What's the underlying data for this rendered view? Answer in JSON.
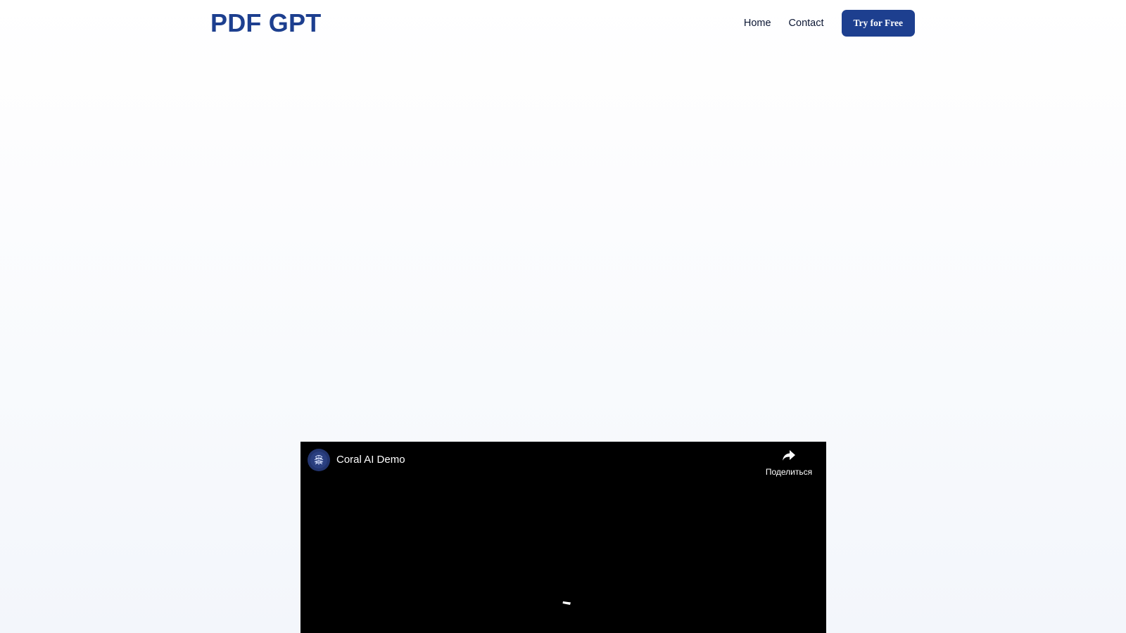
{
  "header": {
    "logo": "PDF GPT",
    "nav": {
      "home": "Home",
      "contact": "Contact",
      "cta": "Try for Free"
    }
  },
  "video": {
    "title": "Coral AI Demo",
    "share_label": "Поделиться",
    "avatar_icon": "brain-icon",
    "share_icon": "share-arrow-icon",
    "loading_icon": "loading-spinner-icon"
  },
  "colors": {
    "brand": "#1d3f8f",
    "nav_text": "#0b1633",
    "video_bg": "#000000"
  }
}
